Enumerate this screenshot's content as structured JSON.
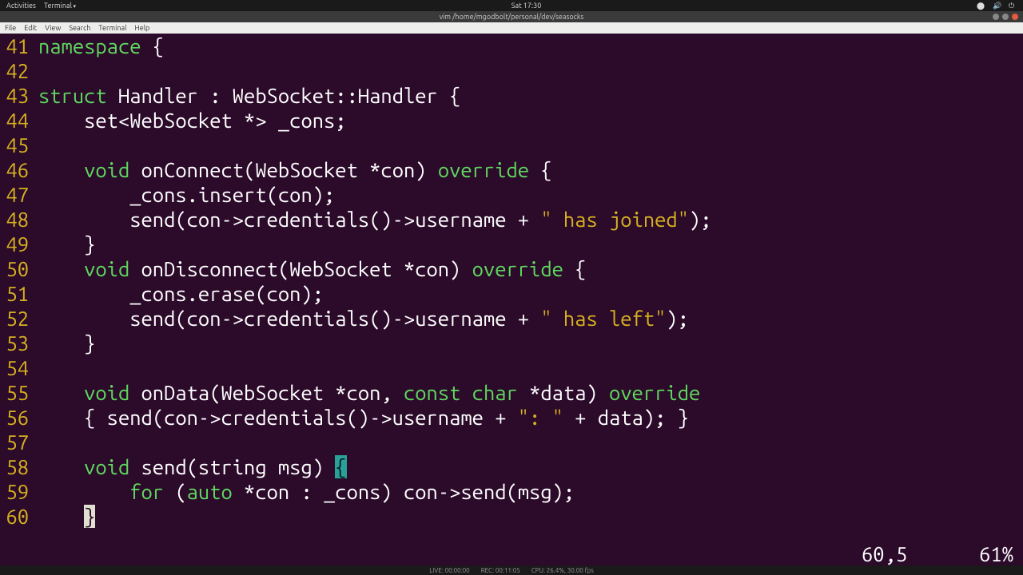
{
  "topbar": {
    "activities": "Activities",
    "appmenu": "Terminal",
    "clock": "Sat 17:30"
  },
  "titlebar": {
    "title": "vim  /home/mgodbolt/personal/dev/seasocks"
  },
  "menubar": {
    "items": [
      "File",
      "Edit",
      "View",
      "Search",
      "Terminal",
      "Help"
    ]
  },
  "code": {
    "lines": [
      {
        "n": 41,
        "tokens": [
          [
            "kw",
            "namespace"
          ],
          [
            "",
            " {"
          ]
        ]
      },
      {
        "n": 42,
        "tokens": []
      },
      {
        "n": 43,
        "tokens": [
          [
            "kw",
            "struct"
          ],
          [
            "",
            " Handler : WebSocket::Handler {"
          ]
        ]
      },
      {
        "n": 44,
        "tokens": [
          [
            "",
            "    set<WebSocket *> _cons;"
          ]
        ]
      },
      {
        "n": 45,
        "tokens": []
      },
      {
        "n": 46,
        "tokens": [
          [
            "",
            "    "
          ],
          [
            "kw",
            "void"
          ],
          [
            "",
            " onConnect(WebSocket *con) "
          ],
          [
            "kw",
            "override"
          ],
          [
            "",
            " {"
          ]
        ]
      },
      {
        "n": 47,
        "tokens": [
          [
            "",
            "        _cons.insert(con);"
          ]
        ]
      },
      {
        "n": 48,
        "tokens": [
          [
            "",
            "        send(con->credentials()->username + "
          ],
          [
            "str",
            "\" has joined\""
          ],
          [
            "",
            ");"
          ]
        ]
      },
      {
        "n": 49,
        "tokens": [
          [
            "",
            "    }"
          ]
        ]
      },
      {
        "n": 50,
        "tokens": [
          [
            "",
            "    "
          ],
          [
            "kw",
            "void"
          ],
          [
            "",
            " onDisconnect(WebSocket *con) "
          ],
          [
            "kw",
            "override"
          ],
          [
            "",
            " {"
          ]
        ]
      },
      {
        "n": 51,
        "tokens": [
          [
            "",
            "        _cons.erase(con);"
          ]
        ]
      },
      {
        "n": 52,
        "tokens": [
          [
            "",
            "        send(con->credentials()->username + "
          ],
          [
            "str",
            "\" has left\""
          ],
          [
            "",
            ");"
          ]
        ]
      },
      {
        "n": 53,
        "tokens": [
          [
            "",
            "    }"
          ]
        ]
      },
      {
        "n": 54,
        "tokens": []
      },
      {
        "n": 55,
        "tokens": [
          [
            "",
            "    "
          ],
          [
            "kw",
            "void"
          ],
          [
            "",
            " onData(WebSocket *con, "
          ],
          [
            "kw",
            "const"
          ],
          [
            "",
            " "
          ],
          [
            "kw",
            "char"
          ],
          [
            "",
            " *data) "
          ],
          [
            "kw",
            "override"
          ],
          [
            "",
            ""
          ]
        ]
      },
      {
        "n": 56,
        "tokens": [
          [
            "",
            "    { send(con->credentials()->username + "
          ],
          [
            "str",
            "\": \""
          ],
          [
            "",
            " + data); }"
          ]
        ]
      },
      {
        "n": 57,
        "tokens": []
      },
      {
        "n": 58,
        "tokens": [
          [
            "",
            "    "
          ],
          [
            "kw",
            "void"
          ],
          [
            "",
            " send(string msg) "
          ],
          [
            "hlbrace",
            "{"
          ]
        ]
      },
      {
        "n": 59,
        "tokens": [
          [
            "",
            "        "
          ],
          [
            "kw",
            "for"
          ],
          [
            "",
            " ("
          ],
          [
            "kw",
            "auto"
          ],
          [
            "",
            " *con : _cons) con->send(msg);"
          ]
        ]
      },
      {
        "n": 60,
        "tokens": [
          [
            "",
            "    "
          ],
          [
            "cursorblock",
            "}"
          ]
        ]
      }
    ]
  },
  "status": {
    "pos": "60,5",
    "pct": "61%"
  },
  "bottombar": {
    "live": "LIVE: 00:00:00",
    "rec": "REC: 00:11:05",
    "cpu": "CPU: 26.4%, 30.00 fps"
  }
}
